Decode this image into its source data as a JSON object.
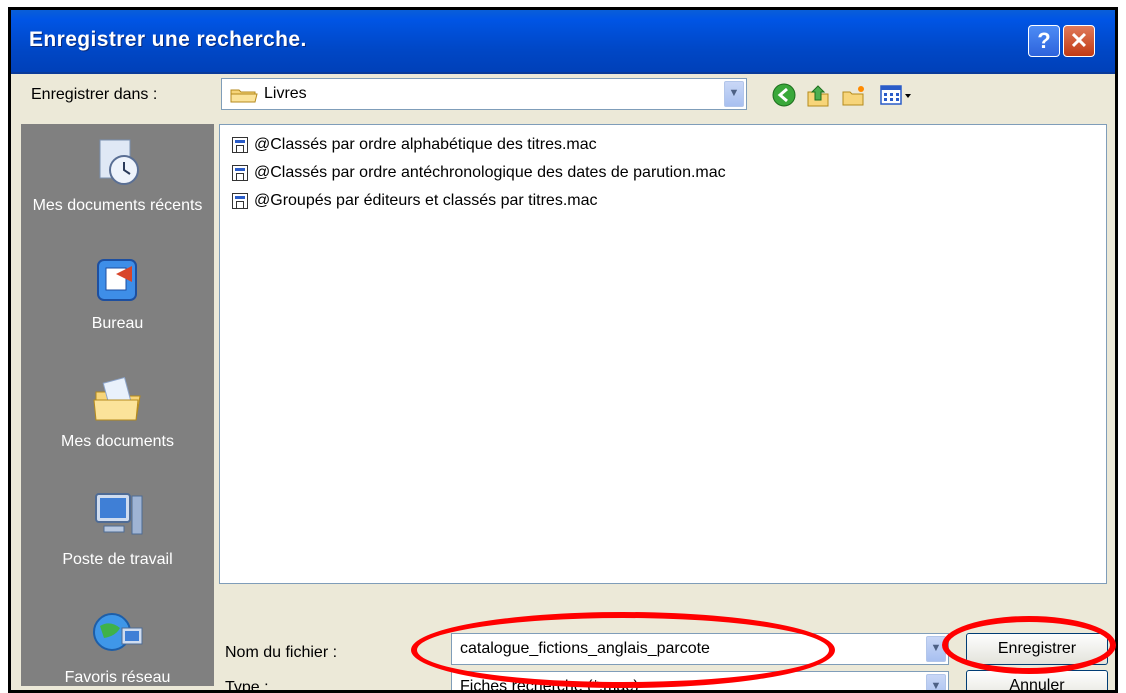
{
  "window": {
    "title": "Enregistrer une recherche.",
    "help_label": "?",
    "close_label": "✕"
  },
  "save_in": {
    "label": "Enregistrer dans :",
    "value": "Livres"
  },
  "toolbar": {
    "icons": [
      "back-icon",
      "up-folder-icon",
      "new-folder-icon",
      "view-menu-icon"
    ]
  },
  "places": [
    {
      "label": "Mes documents récents",
      "icon": "recent-documents-icon"
    },
    {
      "label": "Bureau",
      "icon": "desktop-icon"
    },
    {
      "label": "Mes documents",
      "icon": "my-documents-icon"
    },
    {
      "label": "Poste de travail",
      "icon": "my-computer-icon"
    },
    {
      "label": "Favoris réseau",
      "icon": "network-places-icon"
    }
  ],
  "files": [
    "@Classés par ordre alphabétique des titres.mac",
    "@Classés par ordre antéchronologique des dates de parution.mac",
    "@Groupés par éditeurs et classés par titres.mac"
  ],
  "filename": {
    "label": "Nom du fichier :",
    "value": "catalogue_fictions_anglais_parcote"
  },
  "filetype": {
    "label": "Type :",
    "value": "Fiches recherche (*.mac)"
  },
  "buttons": {
    "save": "Enregistrer",
    "cancel": "Annuler"
  },
  "colors": {
    "titlebar": "#0055e5",
    "dialog_bg": "#ece9d8",
    "highlight": "#ff0000"
  }
}
